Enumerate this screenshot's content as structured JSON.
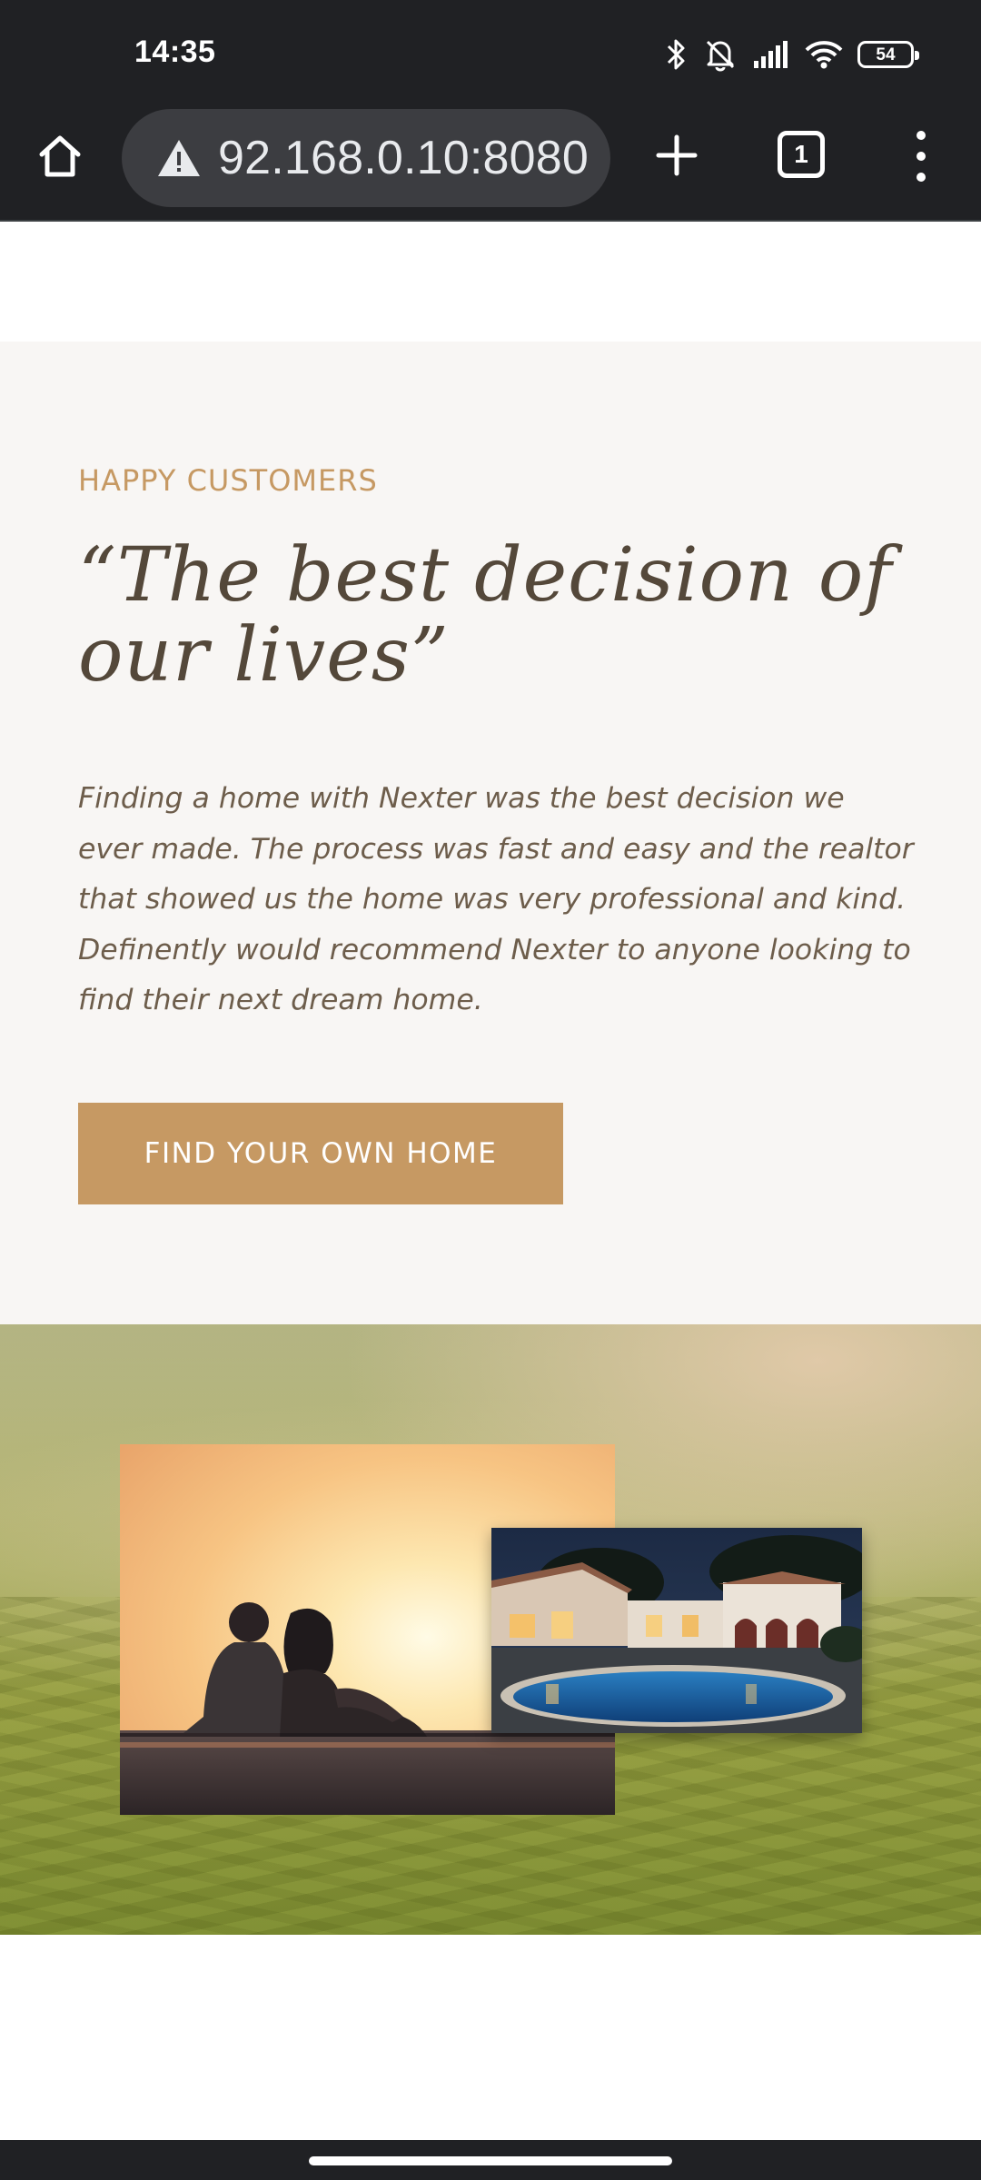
{
  "status_bar": {
    "time": "14:35",
    "battery": "54",
    "icons": [
      "bluetooth-icon",
      "mute-icon",
      "signal-icon",
      "wifi-icon",
      "battery-icon"
    ]
  },
  "browser": {
    "url": "92.168.0.10:8080",
    "tab_count": "1",
    "icons": [
      "home-icon",
      "warning-icon",
      "plus-icon",
      "tabs-icon",
      "more-icon"
    ]
  },
  "testimonial": {
    "eyebrow": "HAPPY CUSTOMERS",
    "quote_line1": "“The best decision of",
    "quote_line2": "our lives”",
    "body": "Finding a home with Nexter was the best decision we ever made. The process was fast and easy and the realtor that showed us the home was very professional and kind. Definently would recommend Nexter to anyone looking to find their next dream home.",
    "cta_label": "FIND YOUR OWN HOME"
  },
  "colors": {
    "accent": "#c69963",
    "heading": "#54483a",
    "body": "#6d5d4b",
    "section_bg": "#f8f6f4",
    "chrome": "#202124"
  }
}
